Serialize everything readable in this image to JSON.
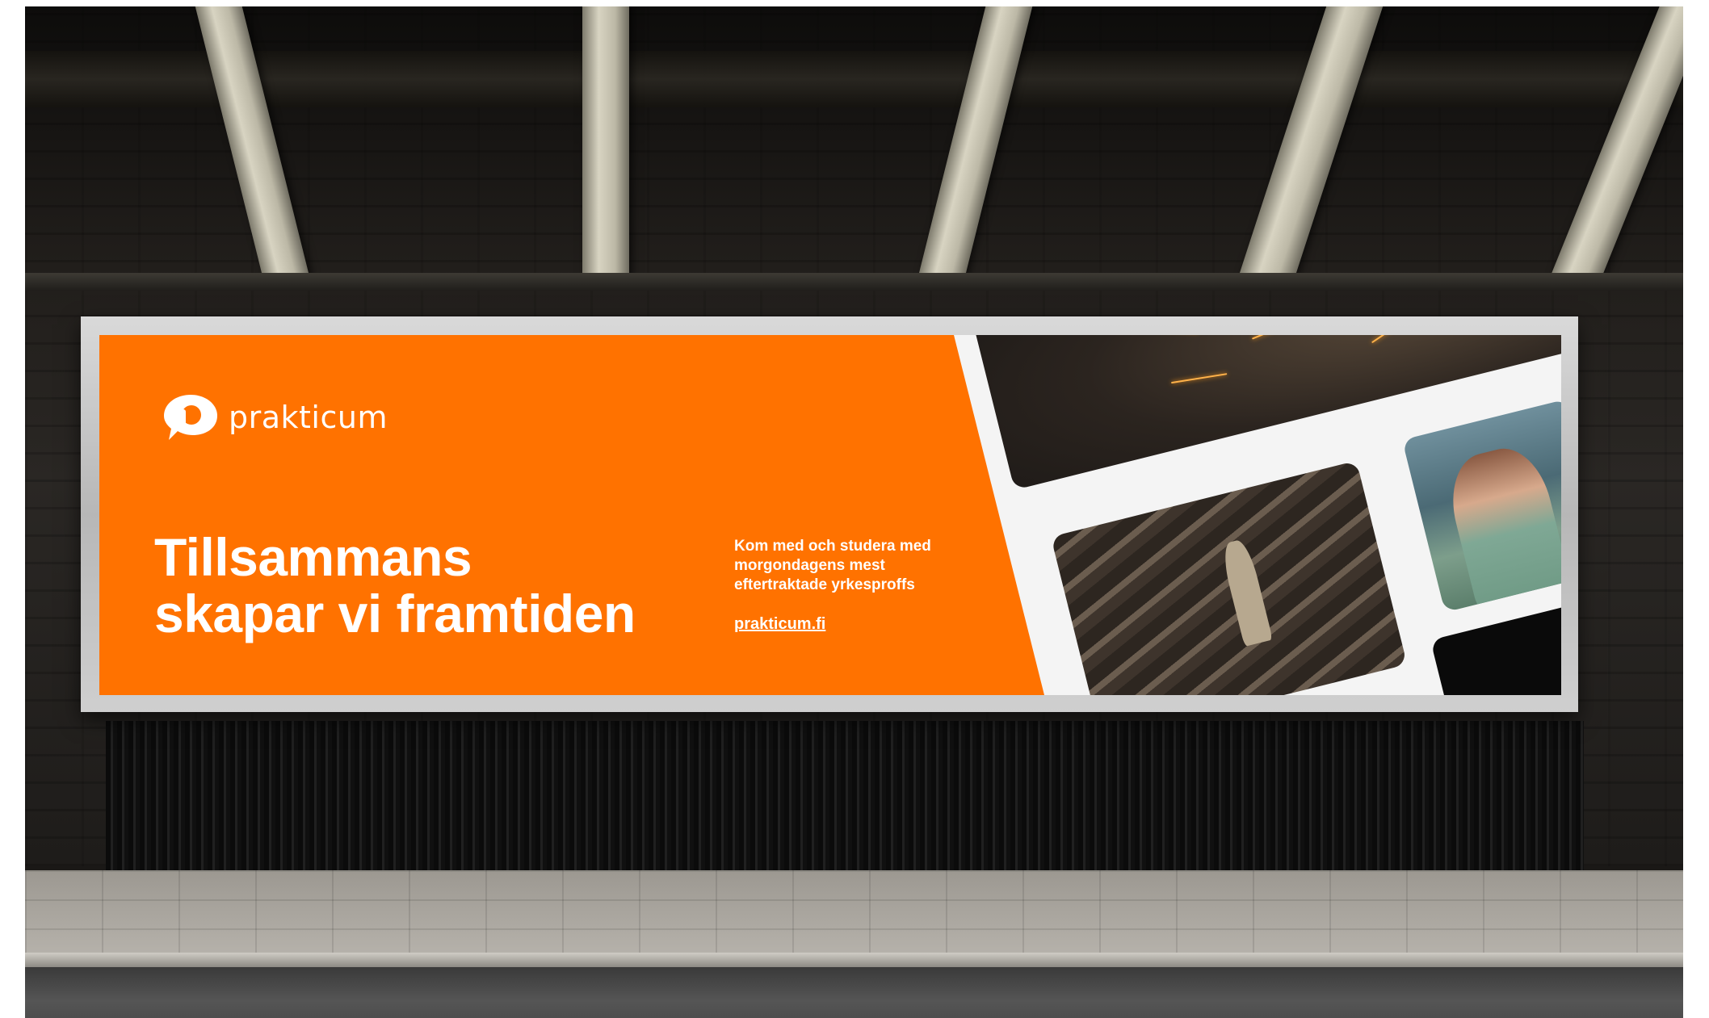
{
  "billboard": {
    "brand": "prakticum",
    "headline": [
      "Tillsammans",
      "skapar vi framtiden"
    ],
    "tagline": [
      "Kom med och studera med",
      "morgondagens mest",
      "eftertraktade yrkesproffs"
    ],
    "url": "prakticum.fi"
  },
  "colors": {
    "brand_orange": "#ff7200",
    "text": "#ffffff",
    "collage_background": "#f4f4f4"
  },
  "photos": [
    "grinder-sparks",
    "person-on-stairs",
    "woman-portrait",
    "dark-panel"
  ]
}
